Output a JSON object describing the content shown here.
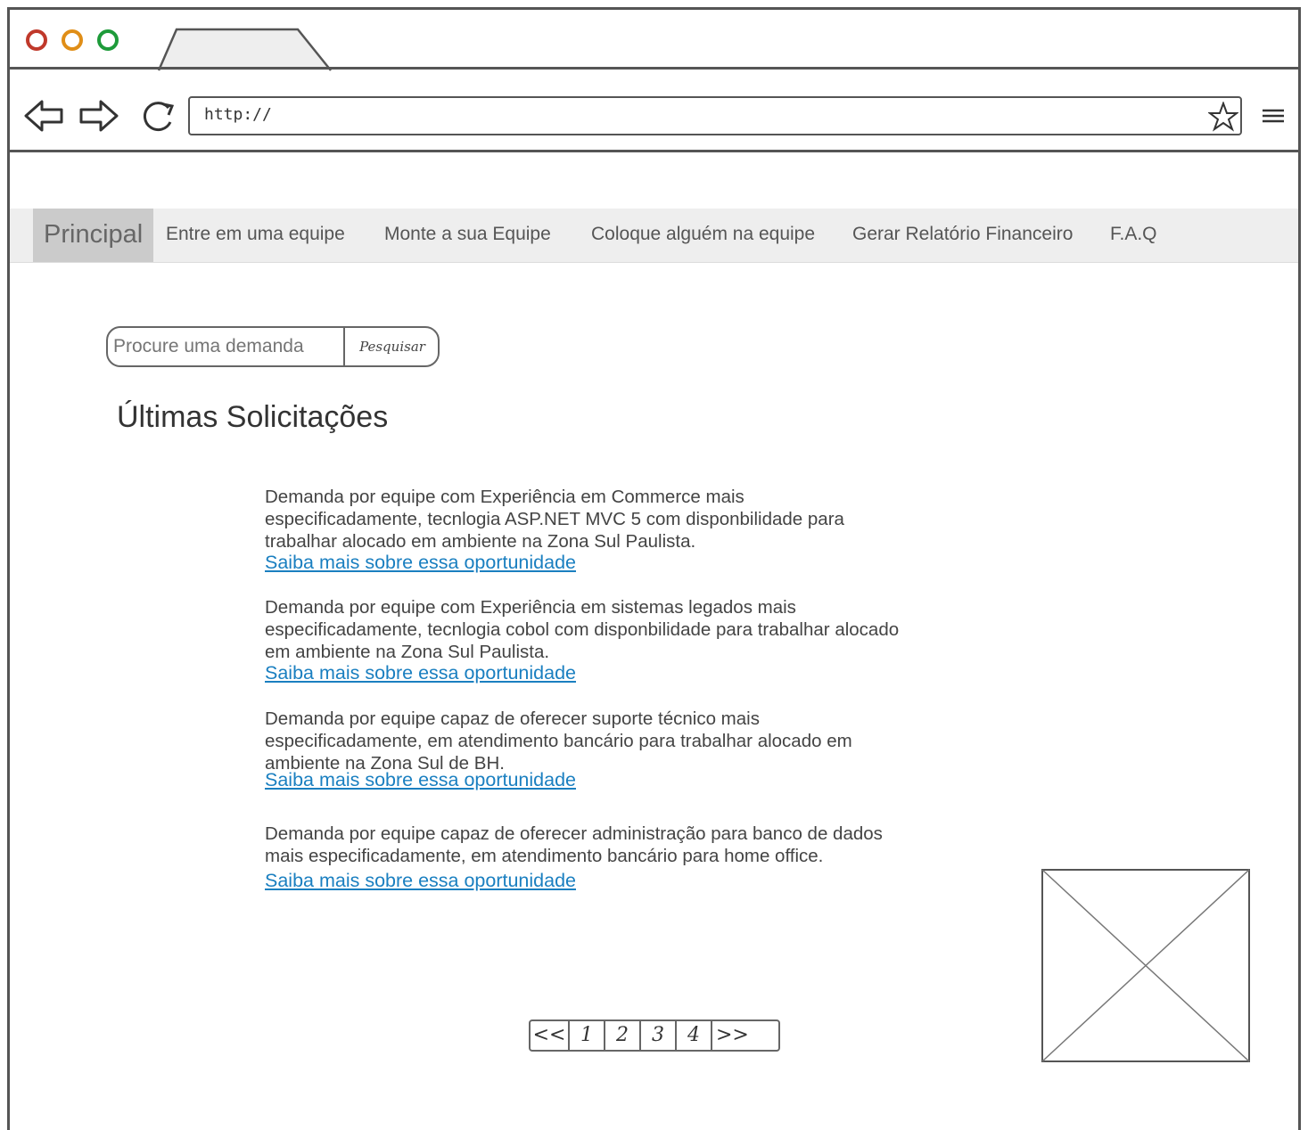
{
  "browser": {
    "url": "http://",
    "traffic_colors": [
      "#c0392b",
      "#e08e17",
      "#1e9b3a"
    ]
  },
  "menu": {
    "items": [
      {
        "label": "Principal",
        "active": true
      },
      {
        "label": "Entre em uma equipe"
      },
      {
        "label": "Monte a sua Equipe"
      },
      {
        "label": "Coloque alguém na equipe"
      },
      {
        "label": "Gerar Relatório Financeiro"
      },
      {
        "label": "F.A.Q"
      }
    ]
  },
  "search": {
    "placeholder": "Procure uma demanda",
    "button_label": "Pesquisar"
  },
  "page_title": "Últimas Solicitações",
  "requests": [
    {
      "text": "Demanda por equipe com Experiência em Commerce mais especificadamente, tecnlogia ASP.NET MVC 5 com disponbilidade para trabalhar alocado em ambiente na Zona Sul Paulista.",
      "link": "Saiba mais sobre essa oportunidade"
    },
    {
      "text": "Demanda por equipe com Experiência em sistemas legados mais especificadamente, tecnlogia cobol com disponbilidade para trabalhar alocado em ambiente na Zona Sul Paulista.",
      "link": "Saiba mais sobre essa oportunidade"
    },
    {
      "text": "Demanda por equipe capaz de oferecer suporte técnico mais especificadamente, em atendimento bancário para trabalhar alocado em ambiente na Zona Sul de BH.",
      "link": "Saiba mais sobre essa oportunidade"
    },
    {
      "text": "Demanda por equipe capaz de oferecer administração para banco de dados mais especificadamente, em atendimento bancário para home office.",
      "link": "Saiba mais sobre essa oportunidade"
    }
  ],
  "pagination": [
    "<<",
    "1",
    "2",
    "3",
    "4",
    ">>"
  ],
  "link_color": "#1a7fc0"
}
